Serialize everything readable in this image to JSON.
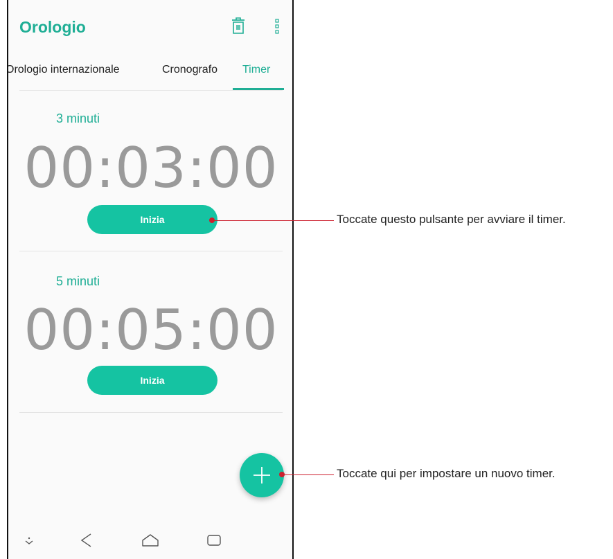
{
  "app": {
    "title": "Orologio"
  },
  "tabs": [
    {
      "label": "Orologio internazionale"
    },
    {
      "label": "Cronografo"
    },
    {
      "label": "Timer"
    }
  ],
  "active_tab": "Timer",
  "timers": [
    {
      "label": "3 minuti",
      "time": "00:03:00",
      "button_label": "Inizia"
    },
    {
      "label": "5 minuti",
      "time": "00:05:00",
      "button_label": "Inizia"
    }
  ],
  "callouts": {
    "start_button": "Toccate questo pulsante per avviare il timer.",
    "add_timer": "Toccate qui per impostare un nuovo timer."
  },
  "colors": {
    "accent": "#1fae95",
    "button": "#15c3a2",
    "callout": "#cc1f2d"
  },
  "icons": [
    "trash-icon",
    "more-vert-icon",
    "plus-icon",
    "download-icon",
    "back-icon",
    "home-icon",
    "recents-icon"
  ]
}
